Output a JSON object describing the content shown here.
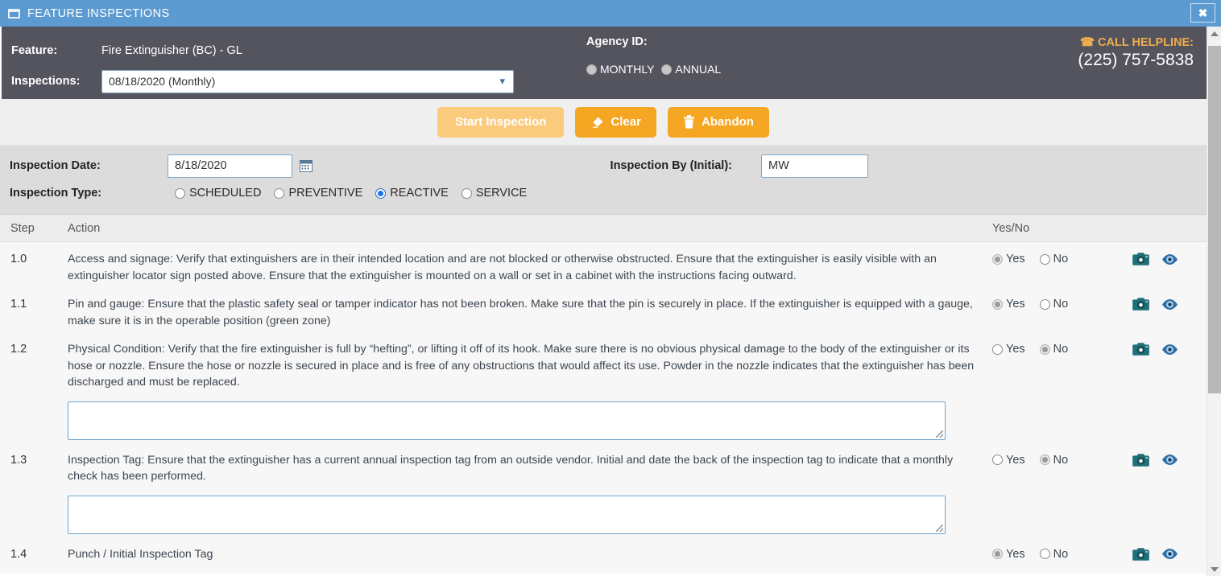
{
  "window": {
    "title": "FEATURE INSPECTIONS",
    "icon": "window-restore-icon",
    "close_label": "✖"
  },
  "feature_bar": {
    "feature_label": "Feature:",
    "feature_value": "Fire Extinguisher (BC) - GL",
    "inspections_label": "Inspections:",
    "inspections_value": "08/18/2020 (Monthly)",
    "chevron": "▾",
    "agency_label": "Agency ID:",
    "agency_options": [
      {
        "label": "MONTHLY",
        "selected": false
      },
      {
        "label": "ANNUAL",
        "selected": false
      }
    ],
    "helpline_label": "CALL HELPLINE:",
    "helpline_icon": "telephone-icon",
    "helpline_number": "(225) 757-5838",
    "accent_color": "#f0ad4e",
    "background_color": "#54545f"
  },
  "toolbar": {
    "start_label": "Start Inspection",
    "clear_label": "Clear",
    "abandon_label": "Abandon",
    "clear_icon": "eraser-icon",
    "abandon_icon": "trash-icon",
    "start_color": "#fbcb7d",
    "action_color": "#f5a623"
  },
  "meta": {
    "date_label": "Inspection Date:",
    "date_value": "8/18/2020",
    "calendar_icon": "calendar-icon",
    "type_label": "Inspection Type:",
    "type_options": [
      {
        "label": "SCHEDULED",
        "selected": false
      },
      {
        "label": "PREVENTIVE",
        "selected": false
      },
      {
        "label": "REACTIVE",
        "selected": true
      },
      {
        "label": "SERVICE",
        "selected": false
      }
    ],
    "inspector_label": "Inspection By (Initial):",
    "inspector_value": "MW"
  },
  "table": {
    "headers": {
      "step": "Step",
      "action": "Action",
      "yesno": "Yes/No"
    },
    "yes_label": "Yes",
    "no_label": "No",
    "camera_icon": "camera-icon",
    "eye_icon": "eye-icon",
    "rows": [
      {
        "step": "1.0",
        "action": "Access and signage: Verify that extinguishers are in their intended location and are not blocked or otherwise obstructed. Ensure that the extinguisher is easily visible with an extinguisher locator sign posted above. Ensure that the extinguisher is mounted on a wall or set in a cabinet with the instructions facing outward.",
        "answer": "Yes",
        "comment": null,
        "comment_value": ""
      },
      {
        "step": "1.1",
        "action": "Pin and gauge: Ensure that the plastic safety seal or tamper indicator has not been broken. Make sure that the pin is securely in place. If the extinguisher is equipped with a gauge, make sure it is in the operable position (green zone)",
        "answer": "Yes",
        "comment": null,
        "comment_value": ""
      },
      {
        "step": "1.2",
        "action": "Physical Condition: Verify that the fire extinguisher is full by “hefting”, or lifting it off of its hook. Make sure there is no obvious physical damage to the body of the extinguisher or its hose or nozzle. Ensure the hose or nozzle is secured in place and is free of any obstructions that would affect its use. Powder in the nozzle indicates that the extinguisher has been discharged and must be replaced.",
        "answer": "No",
        "comment": true,
        "comment_value": ""
      },
      {
        "step": "1.3",
        "action": "Inspection Tag: Ensure that the extinguisher has a current annual inspection tag from an outside vendor. Initial and date the back of the inspection tag to indicate that a monthly check has been performed.",
        "answer": "No",
        "comment": true,
        "comment_value": ""
      },
      {
        "step": "1.4",
        "action": "Punch / Initial Inspection Tag",
        "answer": "Yes",
        "comment": null,
        "comment_value": ""
      }
    ]
  }
}
